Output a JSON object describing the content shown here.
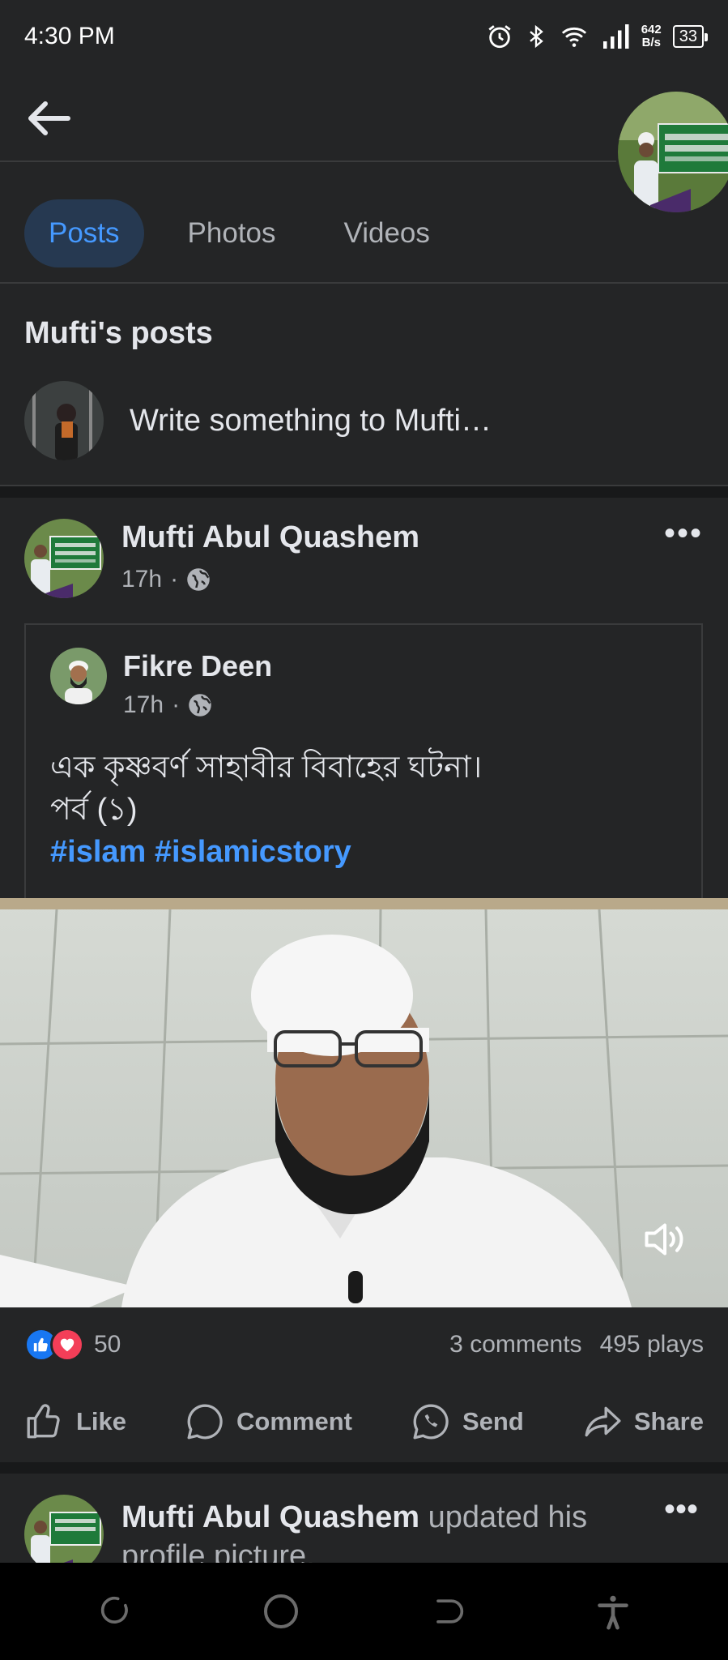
{
  "status": {
    "time": "4:30 PM",
    "speed_value": "642",
    "speed_unit": "B/s",
    "battery": "33"
  },
  "tabs": [
    {
      "label": "Posts",
      "active": true
    },
    {
      "label": "Photos",
      "active": false
    },
    {
      "label": "Videos",
      "active": false
    }
  ],
  "section_title": "Mufti's posts",
  "composer": {
    "placeholder": "Write something to Mufti…"
  },
  "post": {
    "author": "Mufti Abul Quashem",
    "time": "17h",
    "more": "•••",
    "shared": {
      "author": "Fikre Deen",
      "time": "17h",
      "line1": "এক কৃষ্ণবর্ণ সাহাবীর বিবাহের ঘটনা।",
      "line2": "পর্ব (১)",
      "hashtags": "#islam #islamicstory"
    },
    "reaction_count": "50",
    "comments": "3 comments",
    "plays": "495 plays",
    "actions": {
      "like": "Like",
      "comment": "Comment",
      "send": "Send",
      "share": "Share"
    }
  },
  "next_post": {
    "author": "Mufti Abul Quashem",
    "text": " updated his profile picture.",
    "more": "•••"
  },
  "colors": {
    "background": "#242526",
    "accent": "#4599ff",
    "like_blue": "#1877f2",
    "love_red": "#f33e58"
  },
  "icons": [
    "back-arrow-icon",
    "globe-icon",
    "volume-icon",
    "like-icon",
    "comment-icon",
    "messenger-icon",
    "share-icon",
    "alarm-icon",
    "bluetooth-icon",
    "wifi-icon",
    "signal-icon"
  ]
}
